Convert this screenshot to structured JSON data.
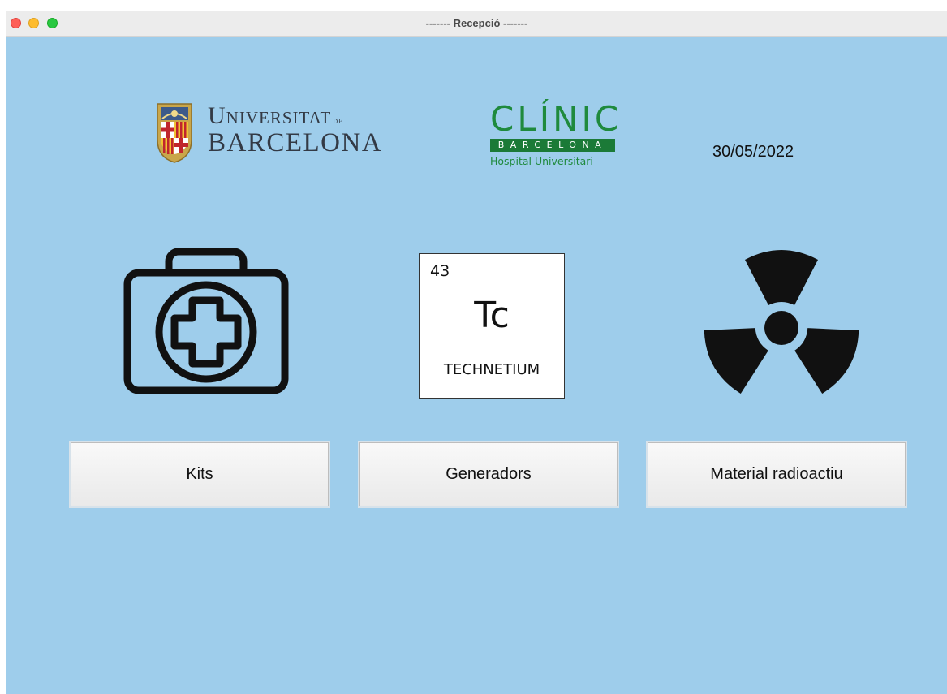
{
  "window": {
    "title": "------- Recepció -------"
  },
  "logos": {
    "university": {
      "line1": "Universitat",
      "de": "de",
      "line2": "BARCELONA",
      "icon": "university-crest-icon"
    },
    "hospital": {
      "name": "CLÍNIC",
      "city": "BARCELONA",
      "subtitle": "Hospital Universitari"
    }
  },
  "date": "30/05/2022",
  "icons": {
    "kits": "medical-kit-icon",
    "element": {
      "number": "43",
      "symbol": "Tc",
      "name": "TECHNETIUM"
    },
    "material": "radiation-icon"
  },
  "buttons": {
    "kits": "Kits",
    "generators": "Generadors",
    "material": "Material radioactiu"
  },
  "colors": {
    "background": "#9ecdeb",
    "clinic_green": "#1f8a3d",
    "ub_text": "#333a45"
  }
}
